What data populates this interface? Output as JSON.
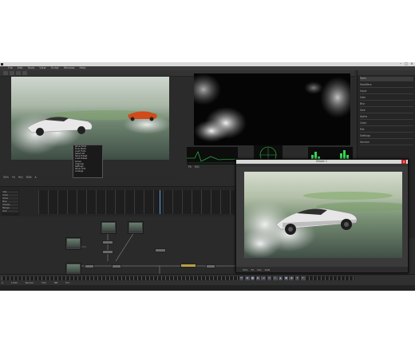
{
  "app": {
    "menu": [
      "File",
      "Edit",
      "Tools",
      "View",
      "Script",
      "Window",
      "Help"
    ],
    "window_controls": [
      "–",
      "□",
      "×"
    ]
  },
  "viewer_left": {
    "status": [
      "50%",
      "Fit",
      "HiQ",
      "RGB",
      "A"
    ]
  },
  "viewer_right": {
    "status": [
      "Fit",
      "HiQ"
    ]
  },
  "context_menu": {
    "items": [
      "Show Tools",
      "Flow Mode",
      "Load Tools",
      "Select All",
      "Save Preset",
      "Load Preset",
      "Group",
      "Ungroup",
      "Settings",
      "Show Grid",
      "Arrange"
    ]
  },
  "inspector": {
    "rows": [
      "Tools",
      "Modifiers",
      "Input",
      "Gain",
      "Blur",
      "Size",
      "Alpha",
      "Color",
      "Mix",
      "Settings",
      "Version"
    ]
  },
  "timeline_list": [
    "Clip",
    "Color",
    "Glow",
    "Blur",
    "Smoke",
    "Merge",
    "Out"
  ],
  "floating_viewer": {
    "title": "Viewer 1",
    "close": "×",
    "status": [
      "50%",
      "Fit",
      "HiQ",
      "RGB"
    ]
  },
  "playback": {
    "controls": [
      "⏮",
      "◀",
      "■",
      "▶",
      "⏭",
      "⟲",
      "✕",
      "▲",
      "●",
      "◆",
      "⏵",
      "⏷"
    ],
    "info": [
      "0",
      "1000",
      "Render",
      "HiQ",
      "MB",
      "Prx"
    ]
  },
  "colors": {
    "accent": "#5a9cff",
    "close_button": "#c62828",
    "scope_green": "#39d353"
  }
}
